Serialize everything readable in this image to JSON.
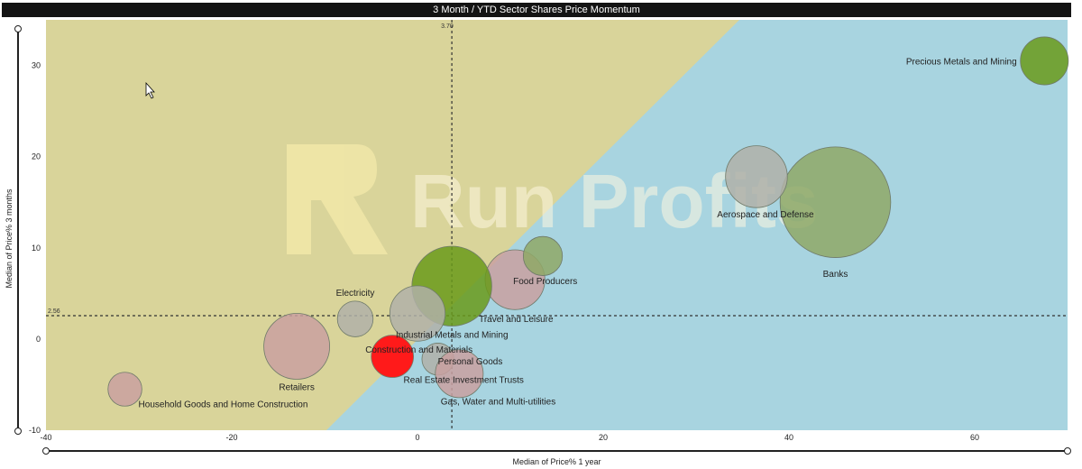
{
  "header": {
    "title": "3 Month / YTD Sector Shares Price Momentum"
  },
  "watermark": {
    "text": "Run Profits",
    "logo_letter": "R"
  },
  "colors": {
    "zone_upper": "#d9d49a",
    "zone_lower": "#a8d4e0",
    "bubble_green": "#6a9a1a",
    "bubble_olive": "#8fa866",
    "bubble_gray": "#b0b0a8",
    "bubble_rose": "#c9a0a0",
    "bubble_red": "#ff1a1a",
    "reference_line": "#333333"
  },
  "icons": {
    "cursor": "mouse-pointer-icon"
  },
  "chart_data": {
    "type": "scatter",
    "title": "3 Month / YTD Sector Shares Price Momentum",
    "xlabel": "Median of Price% 1 year",
    "ylabel": "Median of Price% 3 months",
    "xlim": [
      -40,
      70
    ],
    "ylim": [
      -10,
      35
    ],
    "xticks": [
      -40,
      -20,
      0,
      20,
      40,
      60
    ],
    "yticks": [
      -10,
      0,
      10,
      20,
      30
    ],
    "grid": false,
    "reference_lines": {
      "x": 3.7,
      "y": 2.56,
      "x_label": "3.70",
      "y_label": "2.56"
    },
    "points": [
      {
        "name": "Precious Metals and Mining",
        "x": 67.5,
        "y": 30.5,
        "size": 0.9,
        "color": "green",
        "label_side": "left",
        "label_dy": 0
      },
      {
        "name": "Banks",
        "x": 45,
        "y": 15,
        "size": 4.8,
        "color": "olive",
        "label_side": "below",
        "label_dy": 0
      },
      {
        "name": "Aerospace and Defense",
        "x": 36.5,
        "y": 17.8,
        "size": 1.5,
        "color": "gray",
        "label_side": "below",
        "label_dy": -0.5
      },
      {
        "name": "Food Producers",
        "x": 10.5,
        "y": 6.5,
        "size": 1.4,
        "color": "rose",
        "label_side": "right",
        "label_dy": 0
      },
      {
        "name": "",
        "x": 13.5,
        "y": 9.1,
        "size": 0.6,
        "color": "olive",
        "label_side": "none",
        "label_dy": 0
      },
      {
        "name": "Travel and Leisure",
        "x": 3.7,
        "y": 5.8,
        "size": 2.5,
        "color": "green",
        "label_side": "belowright",
        "label_dy": 0
      },
      {
        "name": "Industrial Metals and Mining",
        "x": 0,
        "y": 2.8,
        "size": 1.2,
        "color": "gray",
        "label_side": "belowright",
        "label_dy": 0
      },
      {
        "name": "Electricity",
        "x": -6.7,
        "y": 2.2,
        "size": 0.5,
        "color": "gray",
        "label_side": "above",
        "label_dy": 0
      },
      {
        "name": "Retailers",
        "x": -13,
        "y": -0.8,
        "size": 1.7,
        "color": "rose",
        "label_side": "below",
        "label_dy": 0
      },
      {
        "name": "Construction and Materials",
        "x": -2.7,
        "y": -1.9,
        "size": 0.7,
        "color": "red",
        "label_side": "rightabove",
        "label_dy": 0
      },
      {
        "name": "Personal Goods",
        "x": 2.2,
        "y": -2.2,
        "size": 0.4,
        "color": "gray",
        "label_side": "none",
        "label_dy": 0
      },
      {
        "name": "Real Estate Investment Trusts",
        "x": 4.5,
        "y": -3.8,
        "size": 0.9,
        "color": "rose",
        "label_side": "none",
        "label_dy": 0
      },
      {
        "name": "Gas, Water and Multi-utilities",
        "x": 5,
        "y": -4,
        "size": 0.0,
        "color": "gray",
        "label_side": "none",
        "label_dy": 0
      },
      {
        "name": "Household Goods and Home Construction",
        "x": -31.5,
        "y": -5.5,
        "size": 0.45,
        "color": "rose",
        "label_side": "belowright",
        "label_dy": 0
      }
    ],
    "free_labels": [
      {
        "text": "Personal Goods",
        "x": 2.2,
        "y": -2.8
      },
      {
        "text": "Real Estate Investment Trusts",
        "x": -1.5,
        "y": -4.8
      },
      {
        "text": "Gas, Water and Multi-utilities",
        "x": 2.5,
        "y": -7.2
      }
    ]
  }
}
